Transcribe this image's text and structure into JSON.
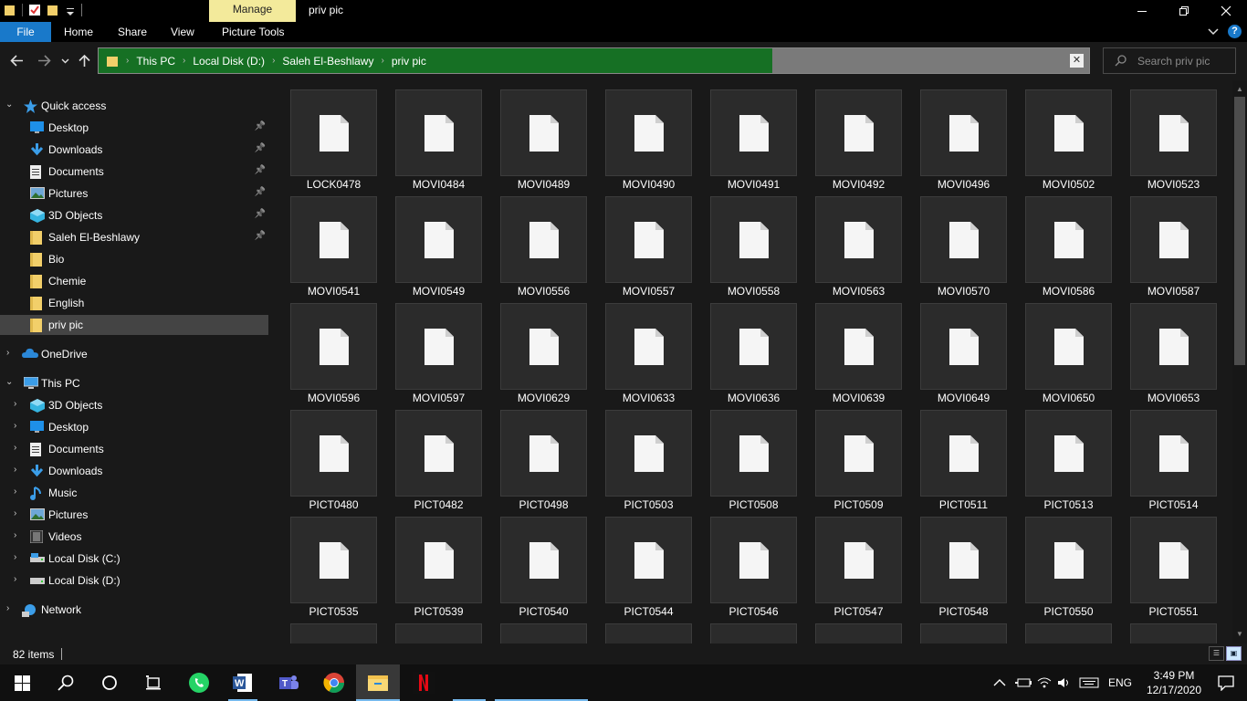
{
  "window": {
    "title": "priv pic",
    "context_tab": "Manage",
    "context_color": "#f3ea9b"
  },
  "ribbon": {
    "tabs": [
      {
        "label": "File"
      },
      {
        "label": "Home"
      },
      {
        "label": "Share"
      },
      {
        "label": "View"
      },
      {
        "label": "Picture Tools"
      }
    ],
    "help_label": "?"
  },
  "address": {
    "crumbs": [
      "This PC",
      "Local Disk (D:)",
      "Saleh El-Beshlawy",
      "priv pic"
    ],
    "progress_fraction": 0.68,
    "progress_color": "#167024"
  },
  "search": {
    "placeholder": "Search priv pic"
  },
  "sidebar": {
    "quick_access": {
      "label": "Quick access",
      "items": [
        {
          "label": "Desktop",
          "icon": "desktop-icon",
          "pinned": true
        },
        {
          "label": "Downloads",
          "icon": "downloads-icon",
          "pinned": true
        },
        {
          "label": "Documents",
          "icon": "documents-icon",
          "pinned": true
        },
        {
          "label": "Pictures",
          "icon": "pictures-icon",
          "pinned": true
        },
        {
          "label": "3D Objects",
          "icon": "3d-objects-icon",
          "pinned": true
        },
        {
          "label": "Saleh El-Beshlawy",
          "icon": "folder-icon",
          "pinned": true
        },
        {
          "label": "Bio",
          "icon": "folder-icon",
          "pinned": false
        },
        {
          "label": "Chemie",
          "icon": "folder-icon",
          "pinned": false
        },
        {
          "label": "English",
          "icon": "folder-icon",
          "pinned": false
        },
        {
          "label": "priv pic",
          "icon": "folder-icon",
          "pinned": false,
          "selected": true
        }
      ]
    },
    "onedrive": {
      "label": "OneDrive"
    },
    "this_pc": {
      "label": "This PC",
      "items": [
        {
          "label": "3D Objects",
          "icon": "3d-objects-icon"
        },
        {
          "label": "Desktop",
          "icon": "desktop-icon"
        },
        {
          "label": "Documents",
          "icon": "documents-icon"
        },
        {
          "label": "Downloads",
          "icon": "downloads-icon"
        },
        {
          "label": "Music",
          "icon": "music-icon"
        },
        {
          "label": "Pictures",
          "icon": "pictures-icon"
        },
        {
          "label": "Videos",
          "icon": "videos-icon"
        },
        {
          "label": "Local Disk (C:)",
          "icon": "drive-c-icon"
        },
        {
          "label": "Local Disk (D:)",
          "icon": "drive-d-icon"
        }
      ]
    },
    "network": {
      "label": "Network"
    }
  },
  "files": [
    "LOCK0478",
    "MOVI0484",
    "MOVI0489",
    "MOVI0490",
    "MOVI0491",
    "MOVI0492",
    "MOVI0496",
    "MOVI0502",
    "MOVI0523",
    "MOVI0541",
    "MOVI0549",
    "MOVI0556",
    "MOVI0557",
    "MOVI0558",
    "MOVI0563",
    "MOVI0570",
    "MOVI0586",
    "MOVI0587",
    "MOVI0596",
    "MOVI0597",
    "MOVI0629",
    "MOVI0633",
    "MOVI0636",
    "MOVI0639",
    "MOVI0649",
    "MOVI0650",
    "MOVI0653",
    "PICT0480",
    "PICT0482",
    "PICT0498",
    "PICT0503",
    "PICT0508",
    "PICT0509",
    "PICT0511",
    "PICT0513",
    "PICT0514",
    "PICT0535",
    "PICT0539",
    "PICT0540",
    "PICT0544",
    "PICT0546",
    "PICT0547",
    "PICT0548",
    "PICT0550",
    "PICT0551",
    "",
    "",
    "",
    "",
    "",
    "",
    "",
    "",
    ""
  ],
  "status": {
    "item_count": "82 items"
  },
  "taskbar": {
    "apps": [
      "start-icon",
      "search-icon",
      "cortana-icon",
      "task-view-icon",
      "whatsapp-icon",
      "word-icon",
      "teams-icon",
      "chrome-icon",
      "file-explorer-icon",
      "netflix-icon"
    ],
    "language": "ENG",
    "time": "3:49 PM",
    "date": "12/17/2020"
  }
}
